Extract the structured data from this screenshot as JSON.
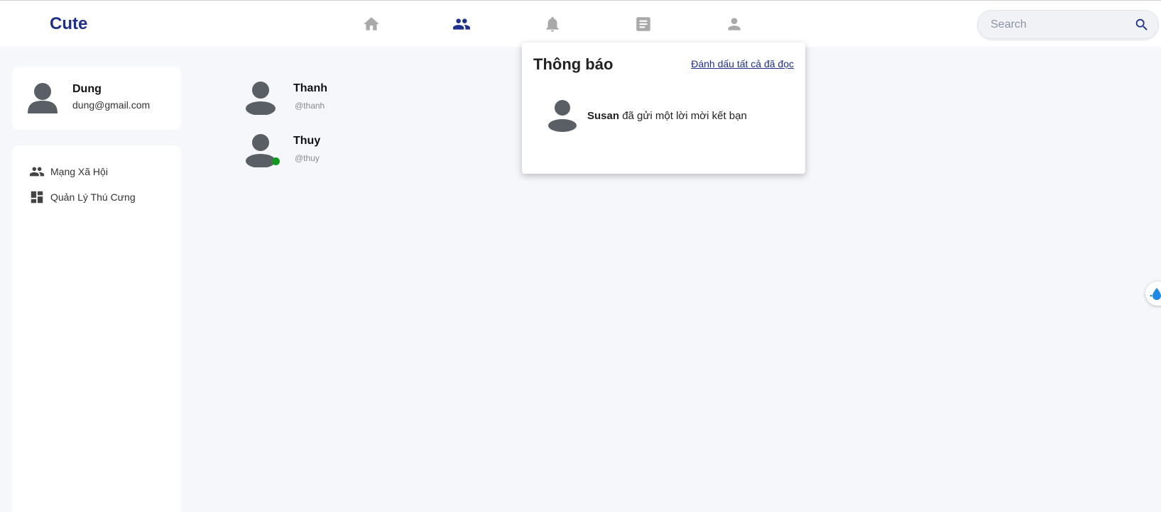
{
  "header": {
    "logo": "Cute",
    "nav": [
      {
        "icon": "home-icon",
        "active": false
      },
      {
        "icon": "people-icon",
        "active": true
      },
      {
        "icon": "bell-icon",
        "active": false
      },
      {
        "icon": "document-icon",
        "active": false
      },
      {
        "icon": "person-icon",
        "active": false
      }
    ],
    "search": {
      "placeholder": "Search",
      "value": ""
    }
  },
  "profile": {
    "name": "Dung",
    "email": "dung@gmail.com"
  },
  "sidebar": {
    "items": [
      {
        "label": "Mạng Xã Hội",
        "icon": "people-icon"
      },
      {
        "label": "Quản Lý Thú Cưng",
        "icon": "dashboard-icon"
      }
    ]
  },
  "friends": [
    {
      "name": "Thanh",
      "handle": "@thanh",
      "online": false
    },
    {
      "name": "Thuy",
      "handle": "@thuy",
      "online": true
    }
  ],
  "notifications": {
    "title": "Thông báo",
    "mark_all": "Đánh dấu tất cả đã đọc",
    "items": [
      {
        "actor": "Susan",
        "message": "đã gửi một lời mời kết bạn"
      }
    ]
  },
  "colors": {
    "brand": "#1e2f8c",
    "icon_inactive": "#a9a9a9",
    "avatar": "#5a5f66",
    "online": "#0f9a1e",
    "background": "#f5f7fb"
  }
}
